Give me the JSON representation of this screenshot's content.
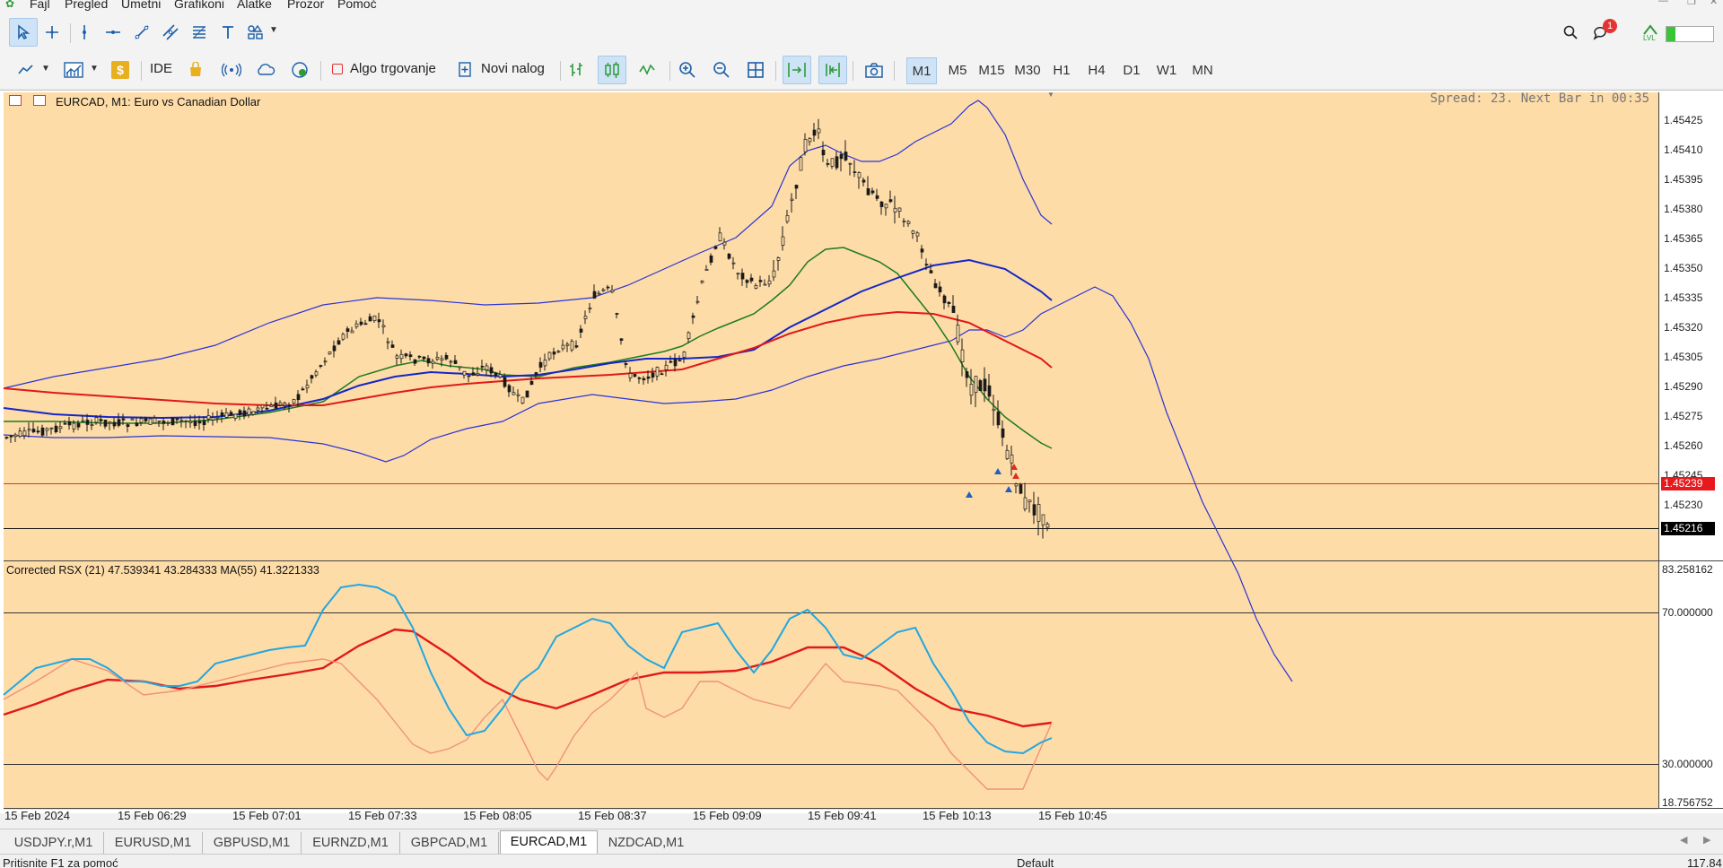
{
  "menu": {
    "items": [
      "Fajl",
      "Pregled",
      "Umetni",
      "Grafikoni",
      "Alatke",
      "Prozor",
      "Pomoć"
    ]
  },
  "toolbar": {
    "ide_label": "IDE",
    "algo_label": "Algo trgovanje",
    "new_order_label": "Novi nalog",
    "notifications_count": "1",
    "lvl_label": "LVL"
  },
  "timeframes": [
    "M1",
    "M5",
    "M15",
    "M30",
    "H1",
    "H4",
    "D1",
    "W1",
    "MN"
  ],
  "active_timeframe": "M1",
  "chart": {
    "title": "EURCAD, M1:  Euro vs Canadian Dollar",
    "spread_text": "Spread: 23. Next Bar in 00:35",
    "price_axis": [
      "1.45425",
      "1.45410",
      "1.45395",
      "1.45380",
      "1.45365",
      "1.45350",
      "1.45335",
      "1.45320",
      "1.45305",
      "1.45290",
      "1.45275",
      "1.45260",
      "1.45245",
      "1.45230"
    ],
    "ask_price": "1.45239",
    "bid_price": "1.45216",
    "ask_color": "#e8191c",
    "bid_color": "#000000",
    "background": "#fddca8"
  },
  "oscillator": {
    "title": "Corrected RSX (21) 47.539341 43.284333 MA(55) 41.3221333",
    "axis_labels": [
      "83.258162",
      "70.000000",
      "30.000000",
      "18.756752"
    ]
  },
  "time_axis": [
    "15 Feb 2024",
    "15 Feb 06:29",
    "15 Feb 07:01",
    "15 Feb 07:33",
    "15 Feb 08:05",
    "15 Feb 08:37",
    "15 Feb 09:09",
    "15 Feb 09:41",
    "15 Feb 10:13",
    "15 Feb 10:45"
  ],
  "tabs": [
    "USDJPY.r,M1",
    "EURUSD,M1",
    "GBPUSD,M1",
    "EURNZD,M1",
    "GBPCAD,M1",
    "EURCAD,M1",
    "NZDCAD,M1"
  ],
  "active_tab": "EURCAD,M1",
  "status": {
    "help_text": "Pritisnite F1 za pomoć",
    "profile": "Default",
    "traffic": "117.84"
  }
}
